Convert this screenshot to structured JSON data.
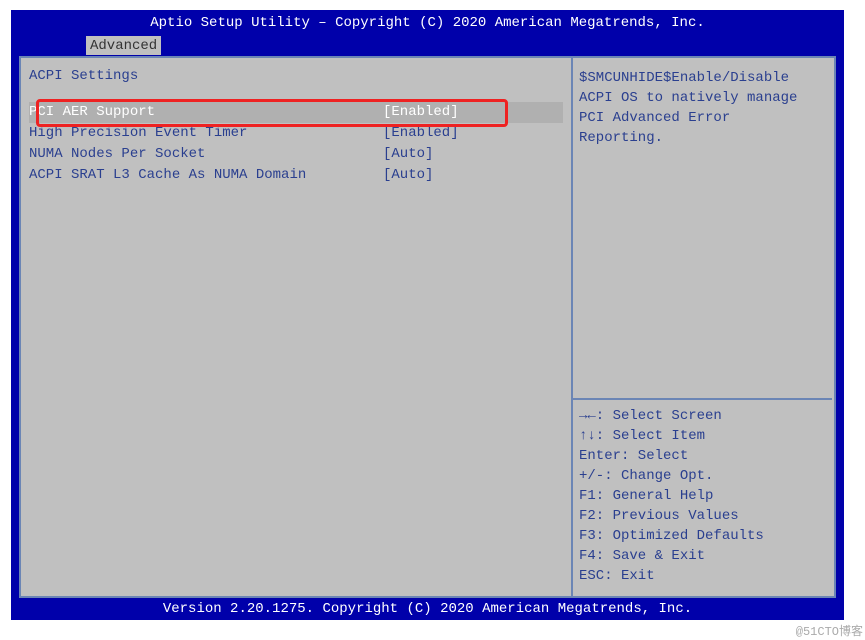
{
  "header": {
    "title": "Aptio Setup Utility – Copyright (C) 2020 American Megatrends, Inc."
  },
  "tab": {
    "label": "Advanced"
  },
  "panel": {
    "section_title": "ACPI Settings",
    "options": [
      {
        "label": "PCI AER Support",
        "value": "[Enabled]",
        "selected": true
      },
      {
        "label": "High Precision Event Timer",
        "value": "[Enabled]",
        "selected": false
      },
      {
        "label": "NUMA Nodes Per Socket",
        "value": "[Auto]",
        "selected": false
      },
      {
        "label": "ACPI SRAT L3 Cache As NUMA Domain",
        "value": "[Auto]",
        "selected": false
      }
    ]
  },
  "help": {
    "text_lines": [
      "$SMCUNHIDE$Enable/Disable",
      "ACPI OS to natively manage",
      "PCI Advanced Error",
      "Reporting."
    ],
    "keys": [
      "→←: Select Screen",
      "↑↓: Select Item",
      "Enter: Select",
      "+/-: Change Opt.",
      "F1: General Help",
      "F2: Previous Values",
      "F3: Optimized Defaults",
      "F4: Save & Exit",
      "ESC: Exit"
    ]
  },
  "footer": {
    "text": "Version 2.20.1275. Copyright (C) 2020 American Megatrends, Inc."
  },
  "watermark": "@51CTO博客"
}
